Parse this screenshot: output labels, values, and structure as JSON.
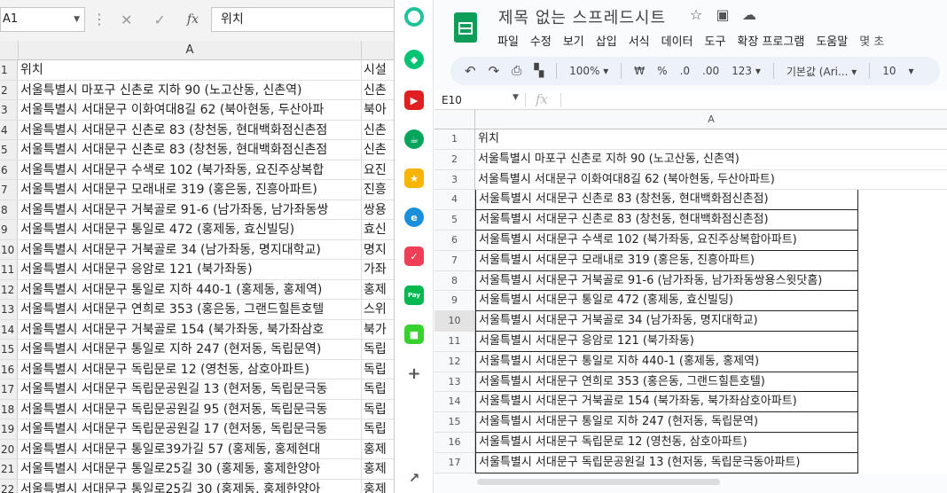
{
  "excel": {
    "name_box": "A1",
    "formula_value": "위치",
    "column_a": "A",
    "rows": [
      {
        "n": "1",
        "a": "위치",
        "b": "시설"
      },
      {
        "n": "2",
        "a": "서울특별시 마포구 신촌로 지하 90 (노고산동, 신촌역)",
        "b": "신촌"
      },
      {
        "n": "3",
        "a": "서울특별시 서대문구 이화여대8길 62 (북아현동, 두산아파",
        "b": "북아"
      },
      {
        "n": "4",
        "a": "서울특별시 서대문구 신촌로 83 (창천동, 현대백화점신촌점",
        "b": "신촌"
      },
      {
        "n": "5",
        "a": "서울특별시 서대문구 신촌로 83 (창천동, 현대백화점신촌점",
        "b": "신촌"
      },
      {
        "n": "6",
        "a": "서울특별시 서대문구 수색로 102 (북가좌동, 요진주상복합",
        "b": "요진"
      },
      {
        "n": "7",
        "a": "서울특별시 서대문구 모래내로 319 (홍은동, 진흥아파트)",
        "b": "진흥"
      },
      {
        "n": "8",
        "a": "서울특별시 서대문구 거북골로 91-6 (남가좌동, 남가좌동쌍",
        "b": "쌍용"
      },
      {
        "n": "9",
        "a": "서울특별시 서대문구 통일로 472 (홍제동, 효신빌딩)",
        "b": "효신"
      },
      {
        "n": "10",
        "a": "서울특별시 서대문구 거북골로 34 (남가좌동, 명지대학교)",
        "b": "명지"
      },
      {
        "n": "11",
        "a": "서울특별시 서대문구 응암로 121 (북가좌동)",
        "b": "가좌"
      },
      {
        "n": "12",
        "a": "서울특별시 서대문구 통일로 지하 440-1 (홍제동, 홍제역)",
        "b": "홍제"
      },
      {
        "n": "13",
        "a": "서울특별시 서대문구 연희로 353 (홍은동, 그랜드힐튼호텔",
        "b": "스위"
      },
      {
        "n": "14",
        "a": "서울특별시 서대문구 거북골로 154 (북가좌동, 북가좌삼호",
        "b": "북가"
      },
      {
        "n": "15",
        "a": "서울특별시 서대문구 통일로 지하 247 (현저동, 독립문역)",
        "b": "독립"
      },
      {
        "n": "16",
        "a": "서울특별시 서대문구 독립문로 12 (영천동, 삼호아파트)",
        "b": "독립"
      },
      {
        "n": "17",
        "a": "서울특별시 서대문구 독립문공원길 13 (현저동, 독립문극동",
        "b": "독립"
      },
      {
        "n": "18",
        "a": "서울특별시 서대문구 독립문공원길 95 (현저동, 독립문극동",
        "b": "독립"
      },
      {
        "n": "19",
        "a": "서울특별시 서대문구 독립문공원길 17 (현저동, 독립문극동",
        "b": "독립"
      },
      {
        "n": "20",
        "a": "서울특별시 서대문구 통일로39가길 57 (홍제동, 홍제현대",
        "b": "홍제"
      },
      {
        "n": "21",
        "a": "서울특별시 서대문구 통일로25길 30 (홍제동, 홍제한양아",
        "b": "홍제"
      },
      {
        "n": "22",
        "a": "서울특별시 서대문구 통일로25길 30 (홍제동, 홍제한양아",
        "b": "홍제"
      }
    ]
  },
  "sidebar": {
    "icons": [
      "circle-app-icon",
      "bell-icon",
      "youtube-icon",
      "cup-icon",
      "star-icon",
      "edge-icon",
      "pocket-icon",
      "pay-icon",
      "square-app-icon",
      "plus-icon",
      "external-link-icon"
    ]
  },
  "sheets": {
    "title": "제목 없는 스프레드시트",
    "menu": [
      "파일",
      "수정",
      "보기",
      "삽입",
      "서식",
      "데이터",
      "도구",
      "확장 프로그램",
      "도움말",
      "몇 초"
    ],
    "toolbar": {
      "zoom": "100%",
      "currency": "₩",
      "percent": "%",
      "dec_decrease": ".0",
      "dec_increase": ".00",
      "number_format": "123",
      "font": "기본값 (Ari...",
      "font_size": "10"
    },
    "cell_ref": "E10",
    "column_a": "A",
    "rows": [
      {
        "n": "1",
        "a": "위치"
      },
      {
        "n": "2",
        "a": "서울특별시 마포구 신촌로 지하 90 (노고산동, 신촌역)"
      },
      {
        "n": "3",
        "a": "서울특별시 서대문구 이화여대8길 62 (북아현동, 두산아파트)"
      },
      {
        "n": "4",
        "a": "서울특별시 서대문구 신촌로 83 (창천동, 현대백화점신촌점)"
      },
      {
        "n": "5",
        "a": "서울특별시 서대문구 신촌로 83 (창천동, 현대백화점신촌점)"
      },
      {
        "n": "6",
        "a": "서울특별시 서대문구 수색로 102 (북가좌동, 요진주상복합아파트)"
      },
      {
        "n": "7",
        "a": "서울특별시 서대문구 모래내로 319 (홍은동, 진흥아파트)"
      },
      {
        "n": "8",
        "a": "서울특별시 서대문구 거북골로 91-6 (남가좌동, 남가좌동쌍용스윗닷홈)"
      },
      {
        "n": "9",
        "a": "서울특별시 서대문구 통일로 472 (홍제동, 효신빌딩)"
      },
      {
        "n": "10",
        "a": "서울특별시 서대문구 거북골로 34 (남가좌동, 명지대학교)"
      },
      {
        "n": "11",
        "a": "서울특별시 서대문구 응암로 121 (북가좌동)"
      },
      {
        "n": "12",
        "a": "서울특별시 서대문구 통일로 지하 440-1 (홍제동, 홍제역)"
      },
      {
        "n": "13",
        "a": "서울특별시 서대문구 연희로 353 (홍은동, 그랜드힐튼호텔)"
      },
      {
        "n": "14",
        "a": "서울특별시 서대문구 거북골로 154 (북가좌동, 북가좌삼호아파트)"
      },
      {
        "n": "15",
        "a": "서울특별시 서대문구 통일로 지하 247 (현저동, 독립문역)"
      },
      {
        "n": "16",
        "a": "서울특별시 서대문구 독립문로 12 (영천동, 삼호아파트)"
      },
      {
        "n": "17",
        "a": "서울특별시 서대문구 독립문공원길 13 (현저동, 독립문극동아파트)"
      }
    ]
  }
}
